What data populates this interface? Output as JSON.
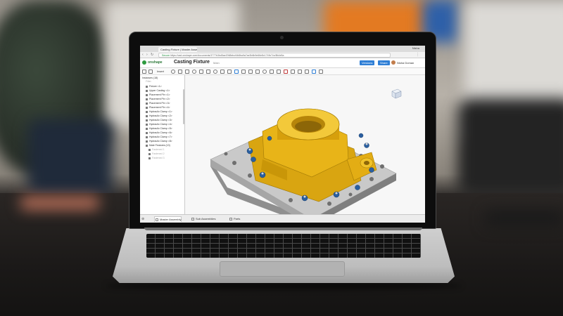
{
  "browser": {
    "tab_title": "Casting Fixture | Master Asse...",
    "user": "Nisha",
    "url_secure": "Secure",
    "url": "https://cad.onshape.com/documents/3777b3bd5ae2068ebcf4b8ba9a7ae3b6b9e66e8c1749c7/w/8b4e5a"
  },
  "app": {
    "logo": "onshape",
    "title": "Casting Fixture",
    "subtitle": "Main",
    "versions_label": "Versions",
    "share_label": "Share",
    "username": "Nisha Doman"
  },
  "toolbar": {
    "insert_label": "Insert"
  },
  "instances": {
    "header": "Instances (18)",
    "filter_placeholder": "Filter",
    "items": [
      "Fixture <1>",
      "Upper Casting <1>",
      "Placement Pin <1>",
      "Placement Pin <2>",
      "Placement Pin <3>",
      "Placement Pin <4>",
      "Hydraulic Clamp <1>",
      "Hydraulic Clamp <2>",
      "Hydraulic Clamp <3>",
      "Hydraulic Clamp <4>",
      "Hydraulic Clamp <5>",
      "Hydraulic Clamp <6>",
      "Hydraulic Clamp <7>",
      "Hydraulic Clamp <8>",
      "Mate Features (13)"
    ],
    "sub_items": [
      "Fastened 1",
      "Fastened 2",
      "Fastened 3"
    ]
  },
  "bottom_tabs": [
    "Master Assembly",
    "Sub Assemblies",
    "Parts"
  ],
  "colors": {
    "casting": "#e8b418",
    "fixture": "#c9c9c9",
    "clamp": "#2a5fa0",
    "accent": "#2f7fd6"
  }
}
